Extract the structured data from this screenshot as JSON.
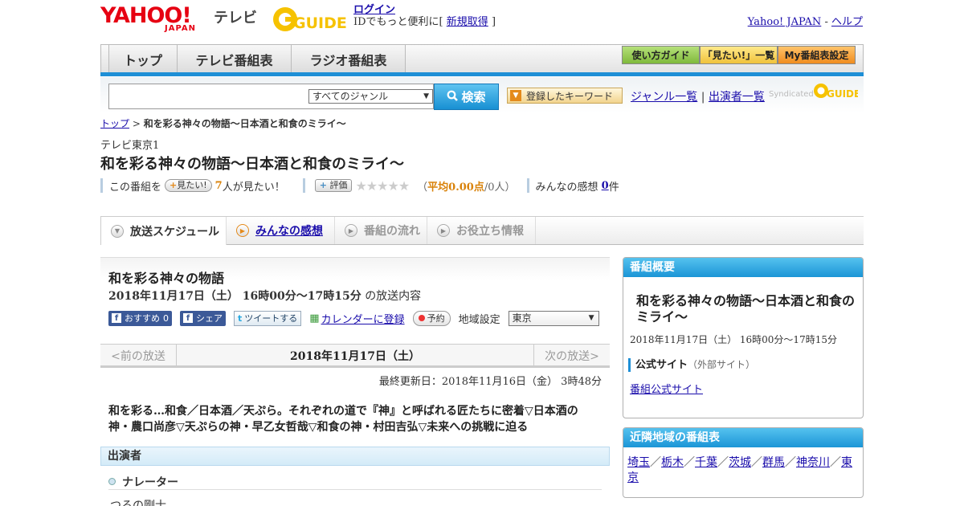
{
  "header": {
    "yahoo_logo": "YAHOO!",
    "japan_logo": "JAPAN",
    "tv_label": "テレビ",
    "guide_logo": "GUIDE",
    "login_link": "ログイン",
    "login_note_prefix": "IDでもっと便利に[",
    "signup_link": "新規取得",
    "login_note_suffix": "]",
    "yahoo_japan_link": "Yahoo! JAPAN",
    "separator": "-",
    "help_link": "ヘルプ"
  },
  "nav": {
    "tabs": [
      "トップ",
      "テレビ番組表",
      "ラジオ番組表"
    ],
    "guide_buttons": [
      "使い方ガイド",
      "「見たい!」一覧",
      "My番組表設定"
    ]
  },
  "search": {
    "genre_select": "すべてのジャンル",
    "search_button": "検索",
    "keyword_button": "登録したキーワード",
    "genre_list_link": "ジャンル一覧",
    "divider": "|",
    "cast_list_link": "出演者一覧",
    "syndicated": "Syndicated"
  },
  "breadcrumb": {
    "home": "トップ",
    "separator": ">",
    "current": "和を彩る神々の物語～日本酒と和食のミライ～"
  },
  "program": {
    "channel": "テレビ東京1",
    "title": "和を彩る神々の物語～日本酒と和食のミライ～",
    "want_prefix": "この番組を",
    "want_button": "見たい!",
    "want_count": "7",
    "want_suffix": "人が見たい！",
    "rate_button": "評価",
    "stars": "★★★★★",
    "avg_open": "（",
    "avg_label": "平均0.00点",
    "avg_count": "/0人）",
    "impressions_label": "みんなの感想",
    "impressions_count": "0",
    "impressions_unit": "件"
  },
  "tabs": [
    "放送スケジュール",
    "みんなの感想",
    "番組の流れ",
    "お役立ち情報"
  ],
  "broadcast": {
    "short_title": "和を彩る神々の物語",
    "datetime": "2018年11月17日（土） 16時00分～17時15分",
    "datetime_suffix": "の放送内容",
    "recommend_label": "おすすめ",
    "recommend_count": "0",
    "share_label": "シェア",
    "tweet_label": "ツイートする",
    "calendar_link": "カレンダーに登録",
    "reserve_label": "予約",
    "region_label": "地域設定",
    "region_value": "東京",
    "prev_label": "<前の放送",
    "current_date": "2018年11月17日（土）",
    "next_label": "次の放送>",
    "updated": "最終更新日：2018年11月16日（金） 3時48分",
    "description": "和を彩る…和食／日本酒／天ぷら。それぞれの道で『神』と呼ばれる匠たちに密着▽日本酒の神・農口尚彦▽天ぷらの神・早乙女哲哉▽和食の神・村田吉弘▽未来への挑戦に迫る",
    "cast_header": "出演者",
    "cast_role": "ナレーター",
    "cast_name": "つるの剛士"
  },
  "sidebar": {
    "overview_header": "番組概要",
    "overview_title": "和を彩る神々の物語～日本酒と和食のミライ～",
    "overview_datetime": "2018年11月17日（土） 16時00分～17時15分",
    "official_label": "公式サイト",
    "official_note": "（外部サイト）",
    "official_link": "番組公式サイト",
    "nearby_header": "近隣地域の番組表",
    "nearby_areas": [
      "埼玉",
      "栃木",
      "千葉",
      "茨城",
      "群馬",
      "神奈川",
      "東京"
    ],
    "nearby_sep": "／"
  },
  "colors": {
    "accent_blue": "#1e8fd6",
    "yahoo_red": "#e60012",
    "guide_yellow": "#f6c200",
    "orange": "#d9820a"
  }
}
